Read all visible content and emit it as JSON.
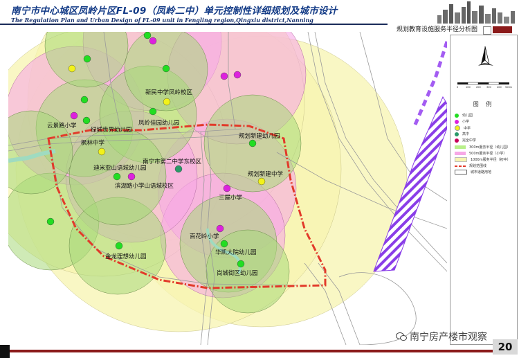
{
  "header": {
    "title_cn": "南宁市中心城区凤岭片区FL-09（凤岭二中）单元控制性详细规划及城市设计",
    "title_en": "The Regulation Plan and Urban Design of FL-09 unit in Fengling region,Qingxiu district,Nanning"
  },
  "subtitle": "规划教育设施服务半径分析图",
  "legend": {
    "title": "图 例",
    "scale_labels": [
      "0",
      "100",
      "200",
      "300",
      "400",
      "500m"
    ],
    "items": [
      {
        "label": "幼儿园",
        "color": "#22dd22",
        "kind": "dot"
      },
      {
        "label": "小学",
        "color": "#dd22dd",
        "kind": "dot"
      },
      {
        "label": "中学",
        "color": "#f2f21a",
        "kind": "dot"
      },
      {
        "label": "高中",
        "color": "#2a9a6a",
        "kind": "dot"
      },
      {
        "label": "完全中学",
        "color": "#c8005a",
        "kind": "dot"
      },
      {
        "label": "300m服务半径（幼儿园）",
        "color": "#b8f08a",
        "kind": "swatch"
      },
      {
        "label": "500m服务半径（小学）",
        "color": "#f7a8e6",
        "kind": "swatch"
      },
      {
        "label": "1000m服务半径（初中）",
        "color": "#f7f4b0",
        "kind": "swatch"
      },
      {
        "label": "规划范围线",
        "color": "#e23a2a",
        "kind": "dashed"
      },
      {
        "label": "城市道路用地",
        "color": "#ffffff",
        "kind": "outline"
      }
    ]
  },
  "map": {
    "labels": [
      {
        "text": "新民中学凤岭校区"
      },
      {
        "text": "云景路小学"
      },
      {
        "text": "绿城世界幼儿园"
      },
      {
        "text": "凤岭佳园幼儿园"
      },
      {
        "text": "规划新建幼儿园"
      },
      {
        "text": "枫林中学"
      },
      {
        "text": "南宁市第二中学东校区"
      },
      {
        "text": "迪米亚山语城幼儿园"
      },
      {
        "text": "滨湖路小学山语城校区"
      },
      {
        "text": "规划新建中学"
      },
      {
        "text": "三屋小学"
      },
      {
        "text": "百花岭小学"
      },
      {
        "text": "华凯大院幼儿园"
      },
      {
        "text": "金龙理想幼儿园"
      },
      {
        "text": "尚城街区幼儿园"
      }
    ]
  },
  "colors": {
    "boundary": "#e23a2a",
    "kindergarten_radius": "#b8f08a",
    "primary_radius": "#f7a8e6",
    "middle_radius": "#f7f4b0",
    "hatch": "#8a3ee8",
    "footer": "#8b1a1a"
  },
  "footer": {
    "watermark": "南宁房产楼市观察",
    "page": "20"
  }
}
